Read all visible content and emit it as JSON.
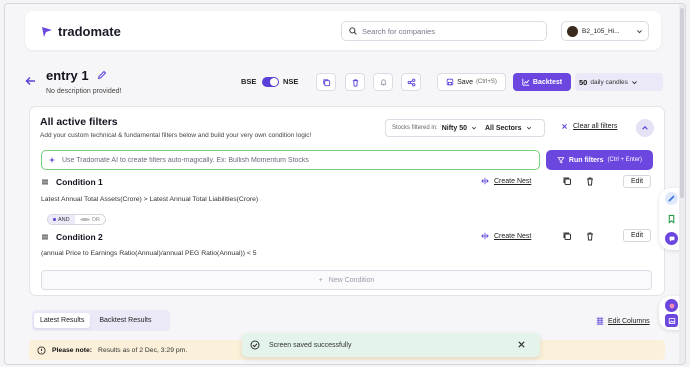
{
  "header": {
    "brand": "tradomate",
    "search_placeholder": "Search for companies",
    "user_name": "B2_105_Hi..."
  },
  "entry": {
    "title": "entry 1",
    "description": "No description provided!"
  },
  "toolbar": {
    "exchange_left": "BSE",
    "exchange_right": "NSE",
    "save_label": "Save",
    "save_shortcut": "(Ctrl+S)",
    "backtest_label": "Backtest",
    "candles_count": "50",
    "candles_unit": "daily candles"
  },
  "filters": {
    "title": "All active filters",
    "subtitle": "Add your custom technical & fundamental filters below and build your very own condition logic!",
    "stocks_label": "Stocks filtered in:",
    "index": "Nifty 50",
    "sector": "All Sectors",
    "clear_all": "Clear all filters",
    "ai_placeholder": "Use Tradomate AI to create filters auto-magically. Ex: Bullish Momentum Stocks",
    "run_label": "Run filters",
    "run_shortcut": "(Ctrl + Enter)",
    "conditions": [
      {
        "title": "Condition 1",
        "expression": "Latest Annual Total Assets(Crore) > Latest Annual Total Liabilities(Crore)",
        "nest_label": "Create Nest",
        "edit_label": "Edit"
      },
      {
        "title": "Condition 2",
        "expression": "(annual Price to Earnings Ratio(Annual)/annual PEG Ratio(Annual)) < 5",
        "nest_label": "Create Nest",
        "edit_label": "Edit"
      }
    ],
    "logic": {
      "and": "AND",
      "or": "OR"
    },
    "new_condition": "New Condition"
  },
  "results": {
    "tabs": [
      "Latest Results",
      "Backtest Results"
    ],
    "edit_columns": "Edit Columns",
    "note_label": "Please note:",
    "note_text": "Results as of 2 Dec, 3:29 pm."
  },
  "toast": {
    "message": "Screen saved successfully"
  },
  "colors": {
    "accent": "#6b47e0",
    "ai_border": "#77d07c",
    "note_bg": "#fbf0d9",
    "toast_bg": "#e4f4ea"
  }
}
